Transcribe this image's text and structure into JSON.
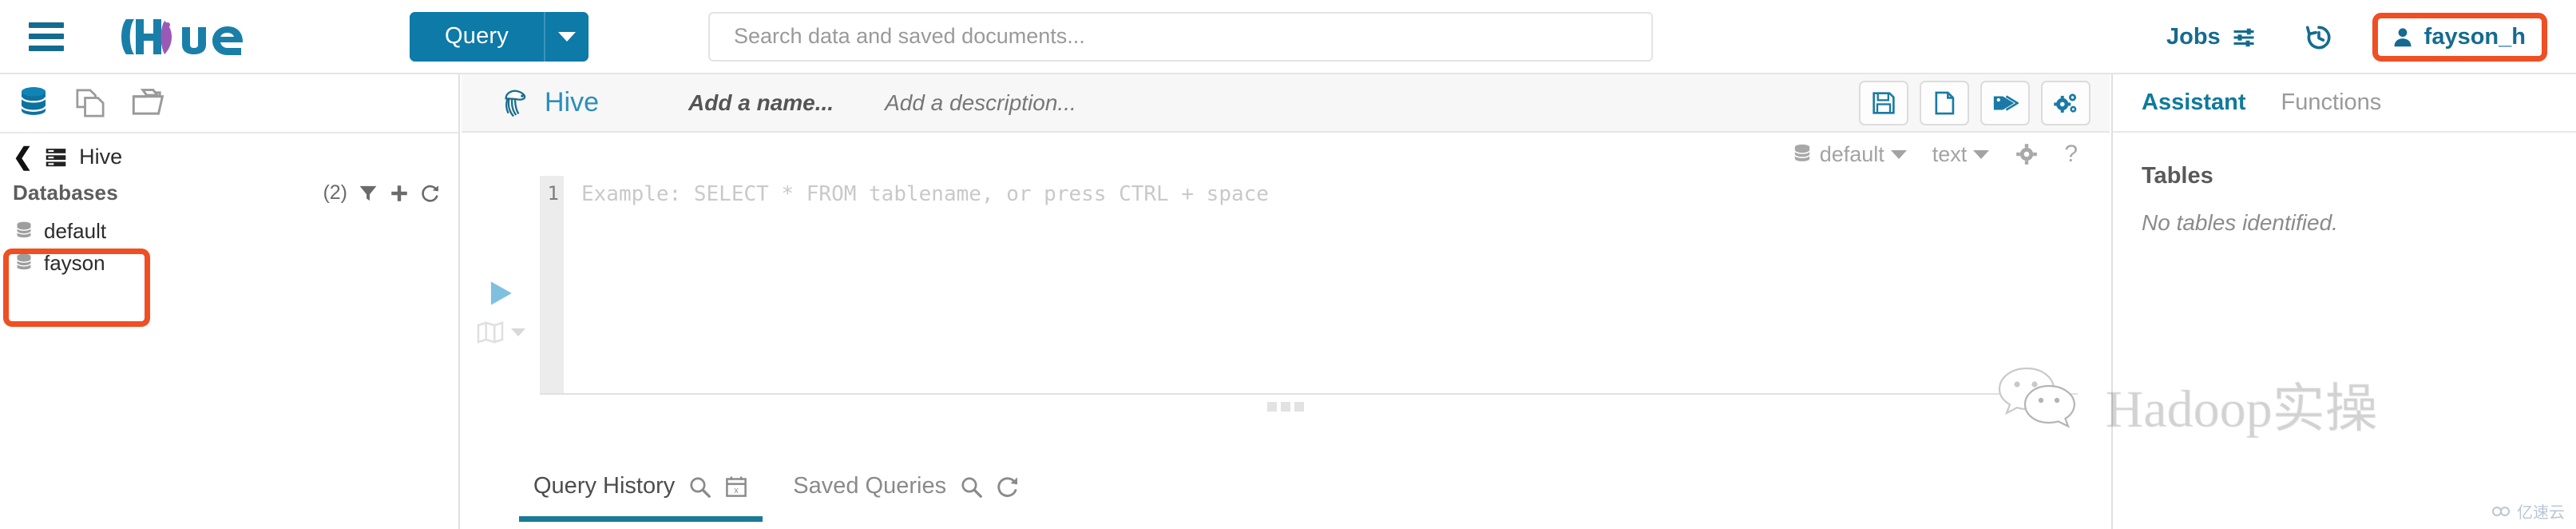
{
  "topbar": {
    "menu_icon": "hamburger-menu-icon",
    "brand": "Hue",
    "query_button": "Query",
    "query_caret_icon": "chevron-down-icon",
    "search_placeholder": "Search data and saved documents...",
    "search_value": "",
    "jobs_label": "Jobs",
    "jobs_icon": "sliders-icon",
    "history_icon": "history-clock-icon",
    "user_name": "fayson_h",
    "user_icon": "user-avatar-icon",
    "user_highlight_color": "#f04e23"
  },
  "sidebar": {
    "icons": [
      {
        "name": "database-icon",
        "active": true
      },
      {
        "name": "documents-icon",
        "active": false
      },
      {
        "name": "open-folder-icon",
        "active": false
      }
    ],
    "breadcrumb_back_icon": "chevron-left-icon",
    "breadcrumb_icon": "hive-server-icon",
    "breadcrumb_label": "Hive",
    "databases_title": "Databases",
    "databases_count": "(2)",
    "header_icons": [
      {
        "name": "filter-icon"
      },
      {
        "name": "plus-icon"
      },
      {
        "name": "refresh-icon"
      }
    ],
    "databases": [
      {
        "label": "default",
        "icon": "database-icon"
      },
      {
        "label": "fayson",
        "icon": "database-icon"
      }
    ],
    "highlight_color": "#f04e23"
  },
  "main": {
    "app_icon": "hive-bee-icon",
    "app_title": "Hive",
    "name_placeholder": "Add a name...",
    "description_placeholder": "Add a description...",
    "header_buttons": [
      {
        "name": "save-button",
        "icon": "floppy-disk-icon"
      },
      {
        "name": "new-document-button",
        "icon": "file-icon"
      },
      {
        "name": "tags-button",
        "icon": "tags-icon"
      },
      {
        "name": "settings-button",
        "icon": "gears-icon"
      }
    ],
    "toolbar": {
      "database_icon": "database-icon",
      "database_value": "default",
      "result_format_value": "text",
      "settings_icon": "gear-icon",
      "help_icon": "question-mark-icon"
    },
    "gutter": {
      "run_icon": "play-triangle-icon",
      "explain_icon": "map-icon",
      "explain_caret_icon": "chevron-down-icon"
    },
    "editor": {
      "line_number": "1",
      "placeholder": "Example: SELECT * FROM tablename, or press CTRL + space",
      "value": ""
    },
    "resize_handle_icon": "grip-dots-icon",
    "bottom_tabs": [
      {
        "label": "Query History",
        "active": true,
        "icons": [
          {
            "name": "search-icon"
          },
          {
            "name": "calendar-clear-icon"
          }
        ]
      },
      {
        "label": "Saved Queries",
        "active": false,
        "icons": [
          {
            "name": "search-icon"
          },
          {
            "name": "refresh-icon"
          }
        ]
      }
    ],
    "active_tab_color": "#1a7b96"
  },
  "right_panel": {
    "tabs": [
      {
        "label": "Assistant",
        "active": true
      },
      {
        "label": "Functions",
        "active": false
      }
    ],
    "section_title": "Tables",
    "empty_message": "No tables identified."
  },
  "watermark": {
    "icon": "wechat-bubbles-icon",
    "text": "Hadoop实操",
    "brand_text": "亿速云",
    "brand_icon": "yisuyun-logo-icon"
  },
  "theme": {
    "primary_blue": "#0d7aa8",
    "teal": "#1a7b96",
    "accent_orange": "#f04e23",
    "hue_purple": "#9b59b6"
  }
}
